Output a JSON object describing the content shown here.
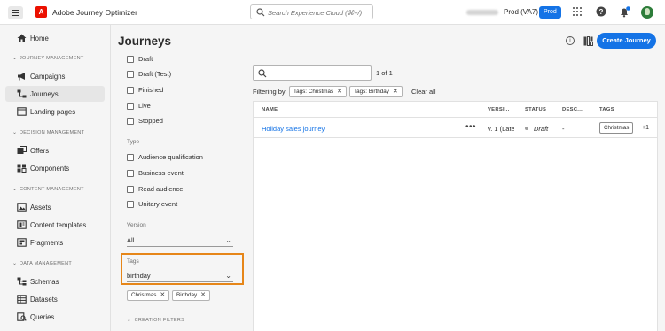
{
  "header": {
    "app_logo": "A",
    "app_title": "Adobe Journey Optimizer",
    "search_placeholder": "Search Experience Cloud (⌘+/)",
    "sandbox": "Prod (VA7)",
    "env_badge": "Prod",
    "icons": [
      "apps-grid-icon",
      "help-icon",
      "notifications-bell-icon",
      "user-avatar"
    ]
  },
  "nav": {
    "home": "Home",
    "sections": [
      {
        "label": "JOURNEY MANAGEMENT",
        "items": [
          "Campaigns",
          "Journeys",
          "Landing pages"
        ]
      },
      {
        "label": "DECISION MANAGEMENT",
        "items": [
          "Offers",
          "Components"
        ]
      },
      {
        "label": "CONTENT MANAGEMENT",
        "items": [
          "Assets",
          "Content templates",
          "Fragments"
        ]
      },
      {
        "label": "DATA MANAGEMENT",
        "items": [
          "Schemas",
          "Datasets",
          "Queries"
        ]
      }
    ],
    "active": "Journeys"
  },
  "page": {
    "title": "Journeys",
    "create_button": "Create Journey"
  },
  "filters": {
    "status_options": [
      "Draft",
      "Draft (Test)",
      "Finished",
      "Live",
      "Stopped"
    ],
    "type_label": "Type",
    "type_options": [
      "Audience qualification",
      "Business event",
      "Read audience",
      "Unitary event"
    ],
    "version_label": "Version",
    "version_value": "All",
    "tags_label": "Tags",
    "tags_value": "birthday",
    "selected_tags": [
      "Christmas",
      "Birthday"
    ],
    "creation_filters": "CREATION FILTERS"
  },
  "results": {
    "search_value": "",
    "count": "1 of 1",
    "filtering_by": "Filtering by",
    "active_filters": [
      "Tags: Christmas",
      "Tags: Birthday"
    ],
    "clear_all": "Clear all",
    "columns": [
      "NAME",
      "VERSI...",
      "STATUS",
      "DESC...",
      "TAGS"
    ],
    "rows": [
      {
        "name": "Holiday sales journey",
        "version": "v. 1 (Late",
        "status": "Draft",
        "description": "-",
        "tag": "Christmas",
        "more_tags": "+1"
      }
    ]
  },
  "colors": {
    "accent": "#1473e6",
    "highlight_box": "#e68619",
    "adobe_red": "#eb1000"
  }
}
